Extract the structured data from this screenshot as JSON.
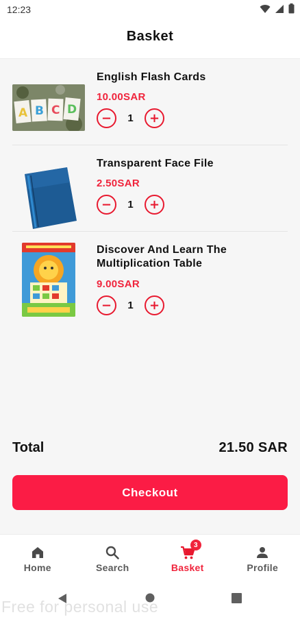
{
  "status_bar": {
    "time": "12:23"
  },
  "header": {
    "title": "Basket"
  },
  "cart": {
    "items": [
      {
        "name": "English Flash Cards",
        "price": "10.00SAR",
        "quantity": "1"
      },
      {
        "name": "Transparent Face File",
        "price": "2.50SAR",
        "quantity": "1"
      },
      {
        "name": "Discover And Learn The Multiplication Table",
        "price": "9.00SAR",
        "quantity": "1"
      }
    ]
  },
  "summary": {
    "total_label": "Total",
    "total_value": "21.50 SAR"
  },
  "checkout": {
    "label": "Checkout"
  },
  "bottom_nav": {
    "items": [
      {
        "label": "Home",
        "icon": "home-icon",
        "active": false
      },
      {
        "label": "Search",
        "icon": "search-icon",
        "active": false
      },
      {
        "label": "Basket",
        "icon": "cart-icon",
        "active": true,
        "badge": "3"
      },
      {
        "label": "Profile",
        "icon": "person-icon",
        "active": false
      }
    ]
  },
  "watermark": {
    "text": "Free for personal use"
  },
  "colors": {
    "accent": "#f0243c",
    "checkout": "#fb1c45",
    "background": "#f6f6f6"
  }
}
